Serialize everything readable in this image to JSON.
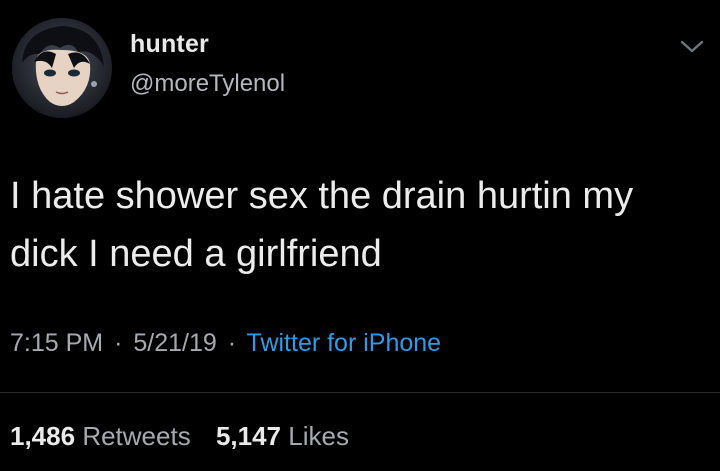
{
  "user": {
    "display_name": "hunter",
    "handle": "@moreTylenol",
    "avatar_icon": "profile-avatar"
  },
  "tweet": {
    "text": "I hate shower sex the drain hurtin my\ndick I need a girlfriend",
    "time": "7:15 PM",
    "date": "5/21/19",
    "separator": "·",
    "source": "Twitter for iPhone"
  },
  "stats": {
    "retweets_count": "1,486",
    "retweets_label": "Retweets",
    "likes_count": "5,147",
    "likes_label": "Likes"
  },
  "icons": {
    "menu": "chevron-down-icon"
  },
  "colors": {
    "background": "#000000",
    "link": "#2f9be8",
    "muted": "#a6aaae"
  }
}
